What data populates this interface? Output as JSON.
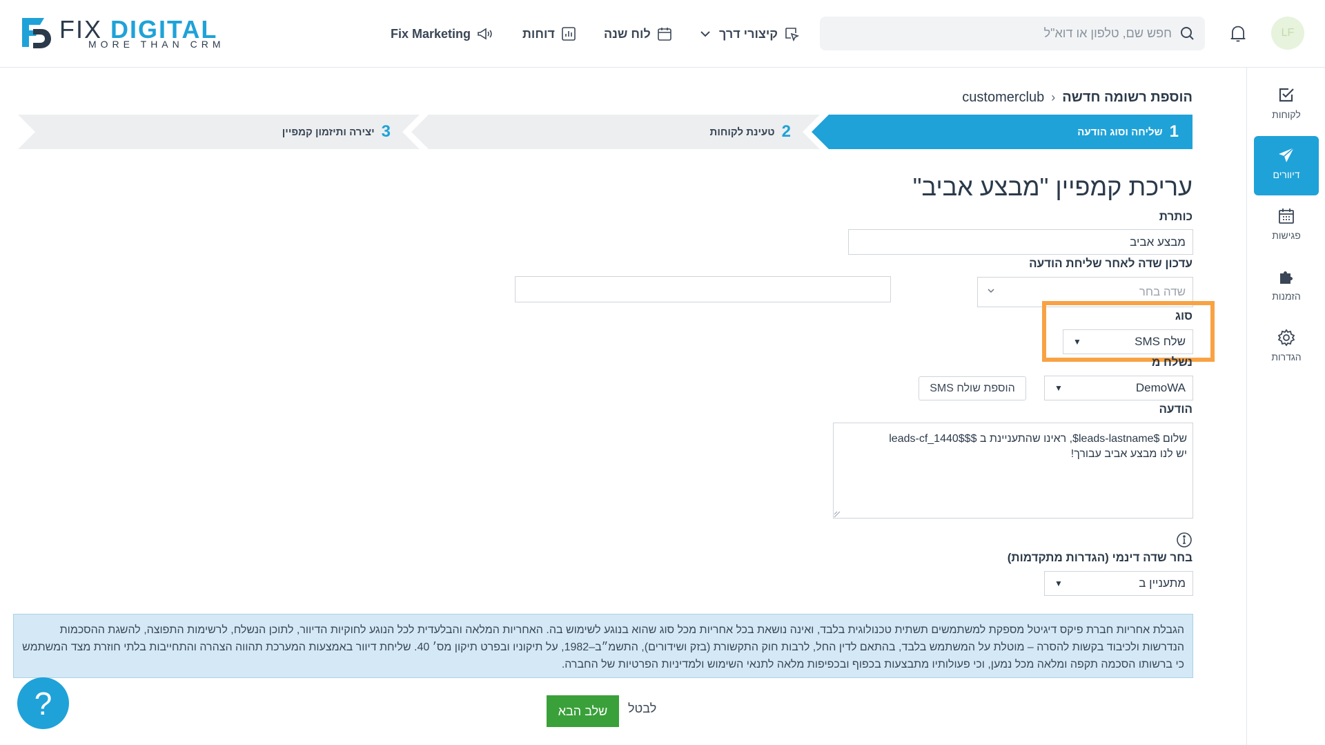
{
  "header": {
    "logo_main": "FIX",
    "logo_accent": "DIGITAL",
    "logo_tagline": "MORE THAN CRM",
    "nav": {
      "marketing": "Fix Marketing",
      "reports": "דוחות",
      "calendar": "לוח שנה",
      "shortcuts": "קיצורי דרך"
    },
    "search_placeholder": "חפש שם, טלפון או דוא\"ל",
    "avatar_initials": "LF"
  },
  "sidebar": {
    "items": [
      {
        "label": "לקוחות"
      },
      {
        "label": "דיוורים"
      },
      {
        "label": "פגישות"
      },
      {
        "label": "הזמנות"
      },
      {
        "label": "הגדרות"
      }
    ]
  },
  "breadcrumb": {
    "root": "customerclub",
    "current": "הוספת רשומה חדשה"
  },
  "steps": [
    {
      "number": "1",
      "label": "שליחה וסוג הודעה"
    },
    {
      "number": "2",
      "label": "טעינת לקוחות"
    },
    {
      "number": "3",
      "label": "יצירה ותיזמון קמפיין"
    }
  ],
  "form": {
    "page_title": "עריכת קמפיין \"מבצע אביב\"",
    "title_label": "כותרת",
    "title_value": "מבצע אביב",
    "update_field_label": "עדכון שדה לאחר שליחת הודעה",
    "update_field_placeholder": "שדה בחר",
    "update_field_value": "",
    "type_label": "סוג",
    "type_value": "שלח SMS",
    "sender_label": "נשלח מ",
    "sender_value": "DemoWA",
    "add_sender_button": "הוספת שולח SMS",
    "message_label": "הודעה",
    "message_line1": "שלום $leads-lastname$, ראינו שהתעניינת ב $$leads-cf_1440$",
    "message_line2": "יש לנו מבצע אביב עבורך!",
    "dynamic_label": "בחר שדה דינמי (הגדרות מתקדמות)",
    "dynamic_value": "מתעניין ב"
  },
  "notice": {
    "text": "הגבלת אחריות חברת פיקס דיגיטל מספקת למשתמשים תשתית טכנולוגית בלבד, ואינה נושאת בכל אחריות מכל סוג שהוא בנוגע לשימוש בה. האחריות המלאה והבלעדית לכל הנוגע לחוקיות הדיוור, לתוכן הנשלח, לרשימות התפוצה, להשגת ההסכמות הנדרשות ולכיבוד בקשות להסרה – מוטלת על המשתמש בלבד, בהתאם לדין החל, לרבות חוק התקשורת (בזק ושידורים), התשמ״ב–1982, על תיקוניו ובפרט תיקון מס׳ 40. שליחת דיוור באמצעות המערכת תהווה הצהרה והתחייבות בלתי חוזרת מצד המשתמש כי ברשותו הסכמה תקפה ומלאה מכל נמען, וכי פעולותיו מתבצעות בכפוף ובכפיפות מלאה לתנאי השימוש ולמדיניות הפרטיות של החברה."
  },
  "footer": {
    "next_button": "שלב הבא",
    "cancel_link": "לבטל",
    "help_symbol": "?"
  },
  "colors": {
    "accent": "#1fa2d8",
    "highlight": "#f8a244",
    "success": "#3aa03a",
    "notice_bg": "#d4e9f5"
  }
}
